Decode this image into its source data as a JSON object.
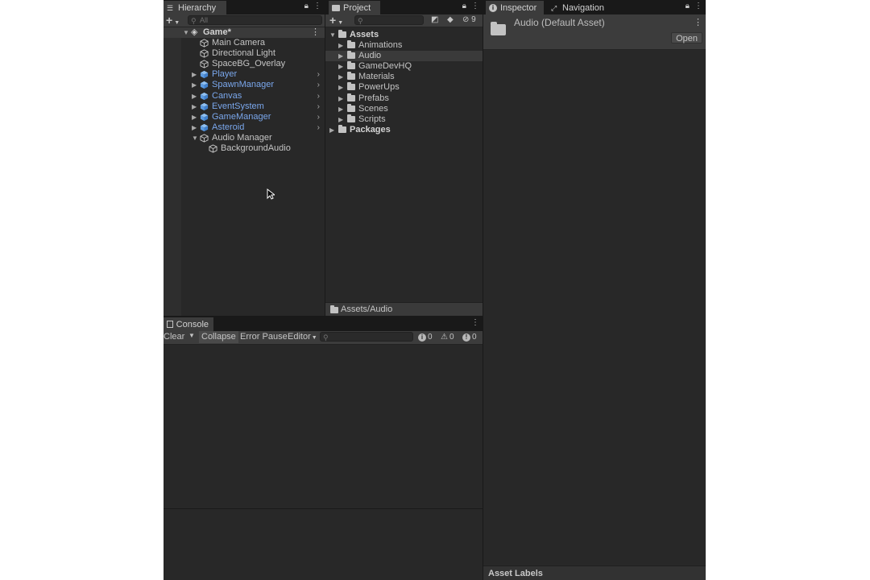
{
  "hierarchy": {
    "tab_label": "Hierarchy",
    "add_label": "+",
    "search_placeholder": "All",
    "scene_name": "Game*",
    "items": [
      {
        "label": "Main Camera",
        "prefab": false
      },
      {
        "label": "Directional Light",
        "prefab": false
      },
      {
        "label": "SpaceBG_Overlay",
        "prefab": false
      },
      {
        "label": "Player",
        "prefab": true
      },
      {
        "label": "SpawnManager",
        "prefab": true
      },
      {
        "label": "Canvas",
        "prefab": true
      },
      {
        "label": "EventSystem",
        "prefab": true
      },
      {
        "label": "GameManager",
        "prefab": true
      },
      {
        "label": "Asteroid",
        "prefab": true
      },
      {
        "label": "Audio Manager",
        "prefab": false
      },
      {
        "label": "BackgroundAudio",
        "prefab": false
      }
    ]
  },
  "project": {
    "tab_label": "Project",
    "add_label": "+",
    "hidden_count": "9",
    "root_label": "Assets",
    "folders": [
      "Animations",
      "Audio",
      "GameDevHQ",
      "Materials",
      "PowerUps",
      "Prefabs",
      "Scenes",
      "Scripts"
    ],
    "selected_folder": "Audio",
    "packages_label": "Packages",
    "footer_path": "Assets/Audio"
  },
  "inspector": {
    "tab_label": "Inspector",
    "nav_tab_label": "Navigation",
    "asset_title": "Audio (Default Asset)",
    "open_button": "Open",
    "asset_labels": "Asset Labels"
  },
  "console": {
    "tab_label": "Console",
    "clear_label": "Clear",
    "collapse_label": "Collapse",
    "error_pause_label": "Error Pause",
    "editor_label": "Editor",
    "info_count": "0",
    "warning_count": "0",
    "error_count": "0"
  },
  "colors": {
    "panel_bg": "#282828",
    "prefab_blue": "#7aa7ec",
    "selection": "#3a3a3a"
  }
}
